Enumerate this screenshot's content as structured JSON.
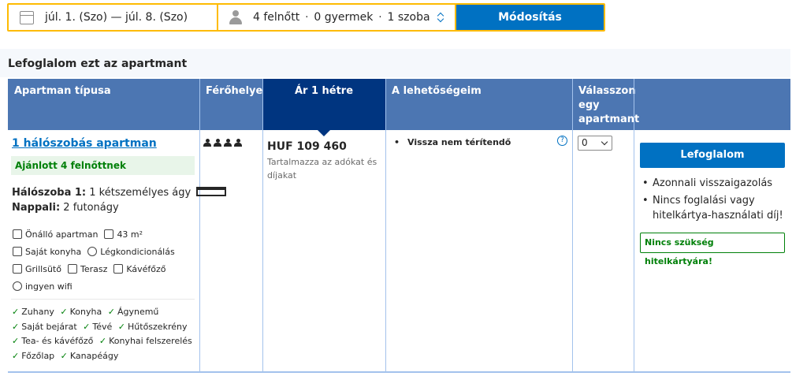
{
  "search": {
    "dates": "júl. 1. (Szo) — júl. 8. (Szo)",
    "adults": "4 felnőtt",
    "children": "0 gyermek",
    "rooms": "1 szoba",
    "sep1": "·",
    "sep2": "·",
    "modify_label": "Módosítás"
  },
  "section_title": "Lefoglalom ezt az apartmant",
  "table": {
    "headers": {
      "type": "Apartman típusa",
      "capacity": "Férőhelyek",
      "price": "Ár 1 hétre",
      "options": "A lehetőségeim",
      "select": "Válasszon egy apartmant"
    }
  },
  "room": {
    "name": "1 hálószobás apartman",
    "recommended": "Ajánlott 4 felnőttnek",
    "bedroom_label": "Hálószoba 1:",
    "bedroom_value": " 1 kétszemélyes ágy",
    "living_label": "Nappali:",
    "living_value": " 2 futonágy",
    "facilities": [
      {
        "icon": "house-icon",
        "label": "Önálló apartman"
      },
      {
        "icon": "area-icon",
        "label": "43 m²"
      },
      {
        "icon": "kitchen-icon",
        "label": "Saját konyha"
      },
      {
        "icon": "snowflake-icon",
        "label": "Légkondicionálás"
      },
      {
        "icon": "grill-icon",
        "label": "Grillsütő"
      },
      {
        "icon": "terrace-icon",
        "label": "Terasz"
      },
      {
        "icon": "coffee-icon",
        "label": "Kávéfőző"
      },
      {
        "icon": "wifi-icon",
        "label": "ingyen wifi"
      }
    ],
    "amenities": [
      "Zuhany",
      "Konyha",
      "Ágynemű",
      "Saját bejárat",
      "Tévé",
      "Hűtőszekrény",
      "Tea- és kávéfőző",
      "Konyhai felszerelés",
      "Főzőlap",
      "Kanapéágy"
    ],
    "capacity": 4,
    "price": "HUF 109 460",
    "price_note": "Tartalmazza az adókat és díjakat",
    "condition": "Vissza nem térítendő",
    "select_value": "0"
  },
  "booking": {
    "button": "Lefoglalom",
    "benefits": [
      "Azonnali visszaigazolás",
      "Nincs foglalási vagy hitelkártya-használati díj!"
    ],
    "no_card": "Nincs szükség hitelkártyára!"
  },
  "colors": {
    "primary": "#0071c2",
    "header_bg": "#4c76b2",
    "price_header_bg": "#003580",
    "accent_yellow": "#febb02",
    "green": "#008009"
  }
}
